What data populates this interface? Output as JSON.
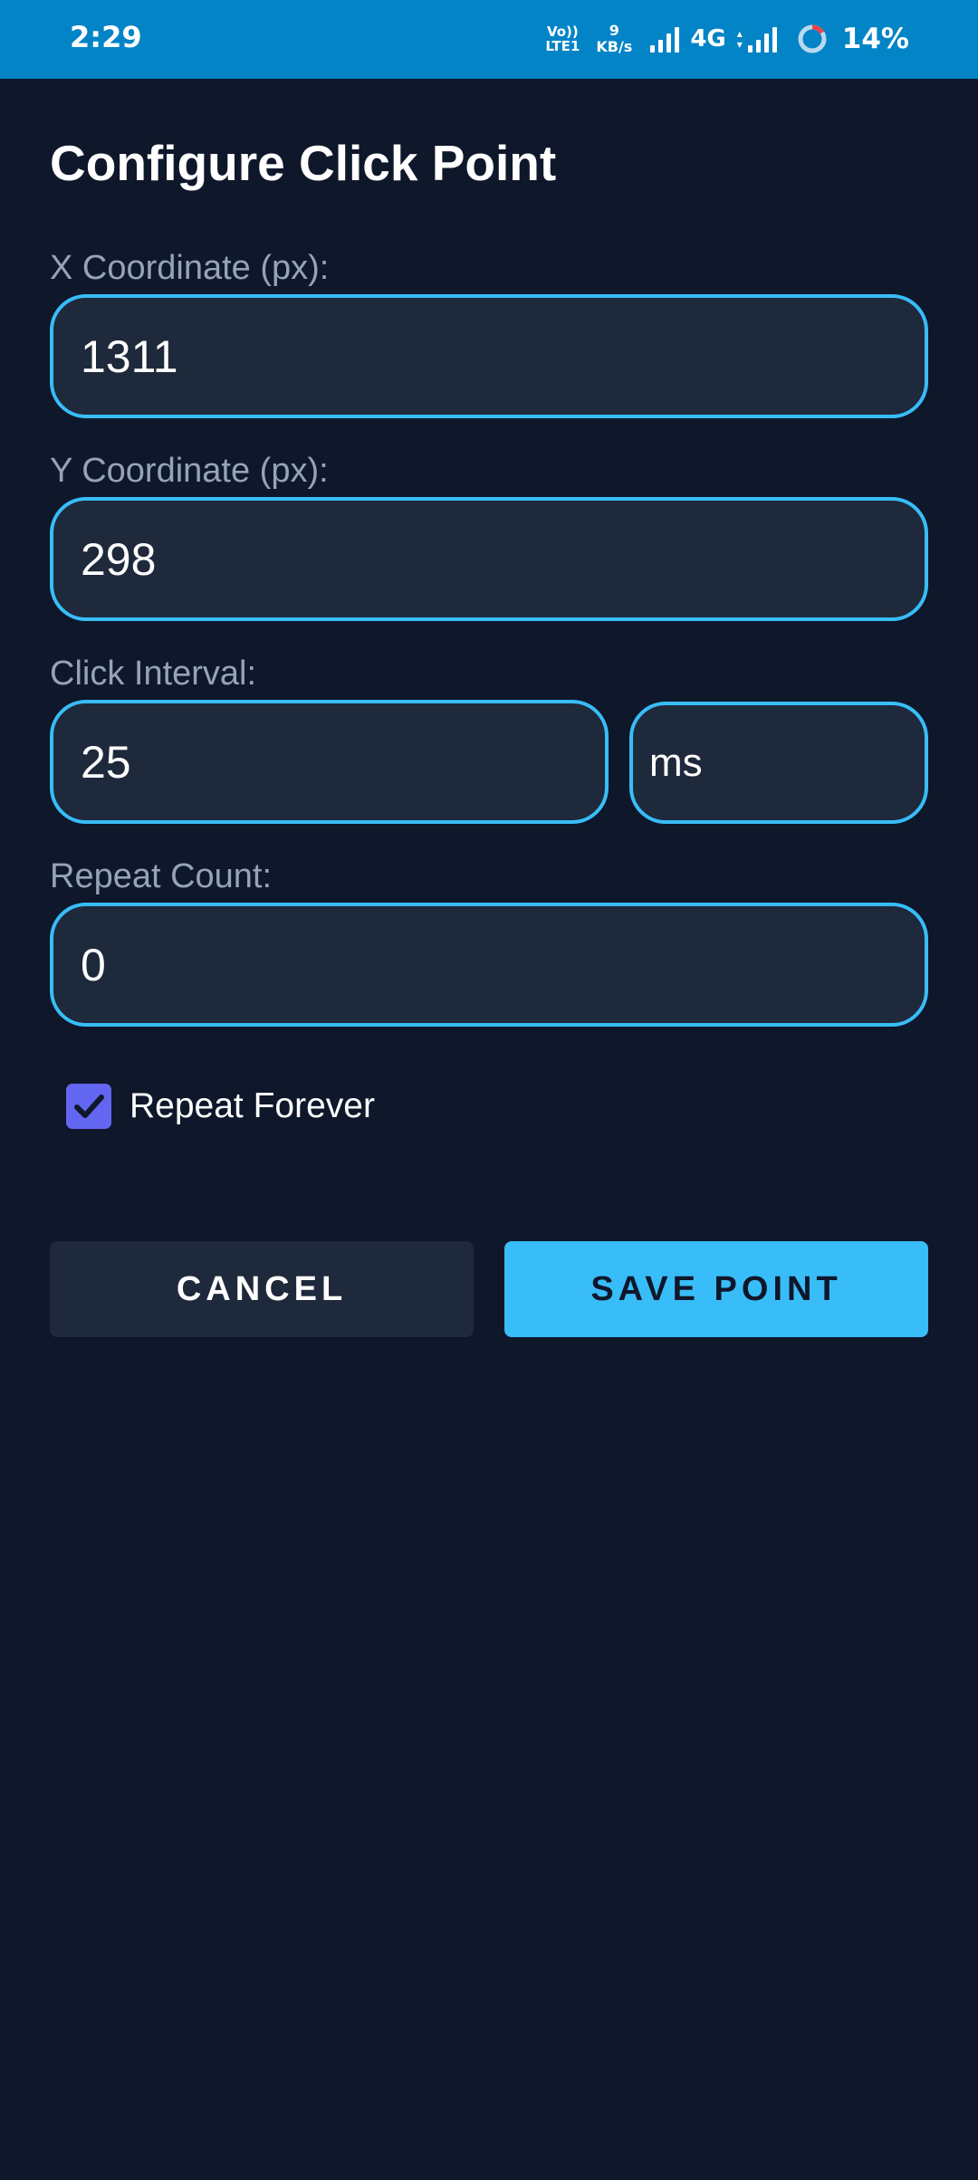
{
  "status_bar": {
    "time": "2:29",
    "volte_top": "Vo))",
    "volte_bottom": "LTE1",
    "speed_value": "9",
    "speed_unit": "KB/s",
    "network": "4G",
    "battery": "14%"
  },
  "title": "Configure Click Point",
  "x_field": {
    "label": "X Coordinate (px):",
    "value": "1311"
  },
  "y_field": {
    "label": "Y Coordinate (px):",
    "value": "298"
  },
  "interval_field": {
    "label": "Click Interval:",
    "value": "25",
    "unit": "ms"
  },
  "repeat_field": {
    "label": "Repeat Count:",
    "value": "0"
  },
  "repeat_forever": {
    "label": "Repeat Forever",
    "checked": true
  },
  "buttons": {
    "cancel": "CANCEL",
    "save": "SAVE POINT"
  },
  "colors": {
    "background": "#0f172a",
    "status_bar": "#0284c7",
    "field_bg": "#1e293b",
    "field_border": "#38bdf8",
    "checkbox": "#6366f1",
    "primary_button": "#38bdf8"
  },
  "icons": {
    "signal": "signal-bars-icon",
    "battery": "battery-ring-icon",
    "check": "checkmark-icon"
  }
}
